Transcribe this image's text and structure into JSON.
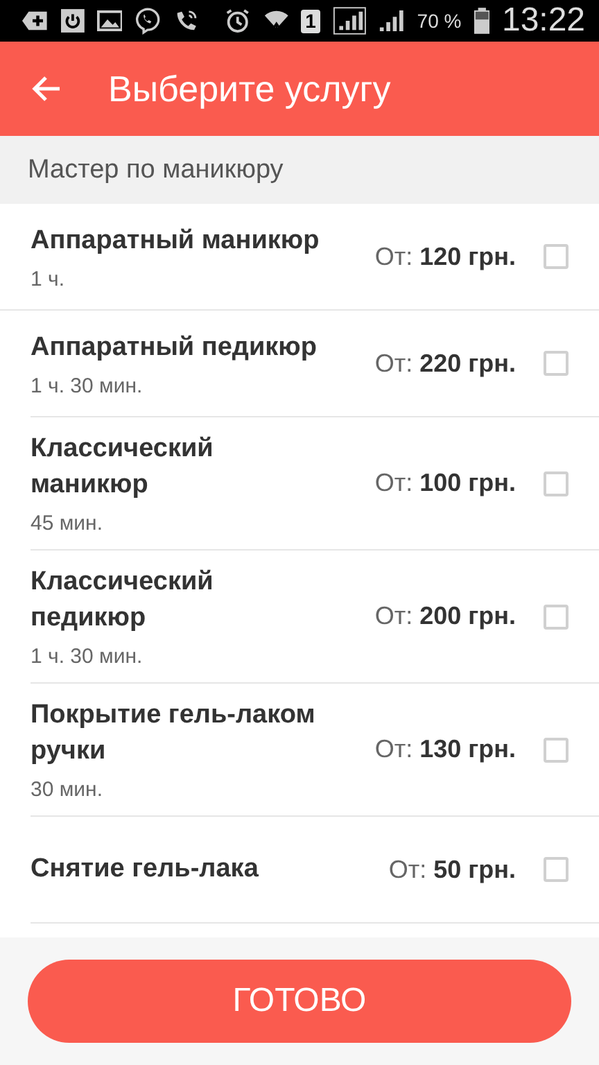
{
  "status_bar": {
    "sim_slot": "1",
    "battery": "70 %",
    "time": "13:22"
  },
  "app_bar": {
    "title": "Выберите услугу"
  },
  "section": {
    "title": "Мастер по маникюру"
  },
  "services": [
    {
      "name": "Аппаратный маникюр",
      "duration": "1 ч.",
      "price_prefix": "От:",
      "price": "120 грн.",
      "checked": false
    },
    {
      "name": "Аппаратный педикюр",
      "duration": "1 ч. 30 мин.",
      "price_prefix": "От:",
      "price": "220 грн.",
      "checked": false
    },
    {
      "name": "Классический маникюр",
      "duration": "45 мин.",
      "price_prefix": "От:",
      "price": "100 грн.",
      "checked": false
    },
    {
      "name": "Классический педикюр",
      "duration": "1 ч. 30 мин.",
      "price_prefix": "От:",
      "price": "200 грн.",
      "checked": false
    },
    {
      "name": "Покрытие гель-лаком ручки",
      "duration": "30 мин.",
      "price_prefix": "От:",
      "price": "130 грн.",
      "checked": false
    },
    {
      "name": "Снятие гель-лака",
      "price_prefix": "От:",
      "price": "50 грн.",
      "checked": false
    }
  ],
  "done_button": {
    "label": "ГОТОВО"
  }
}
